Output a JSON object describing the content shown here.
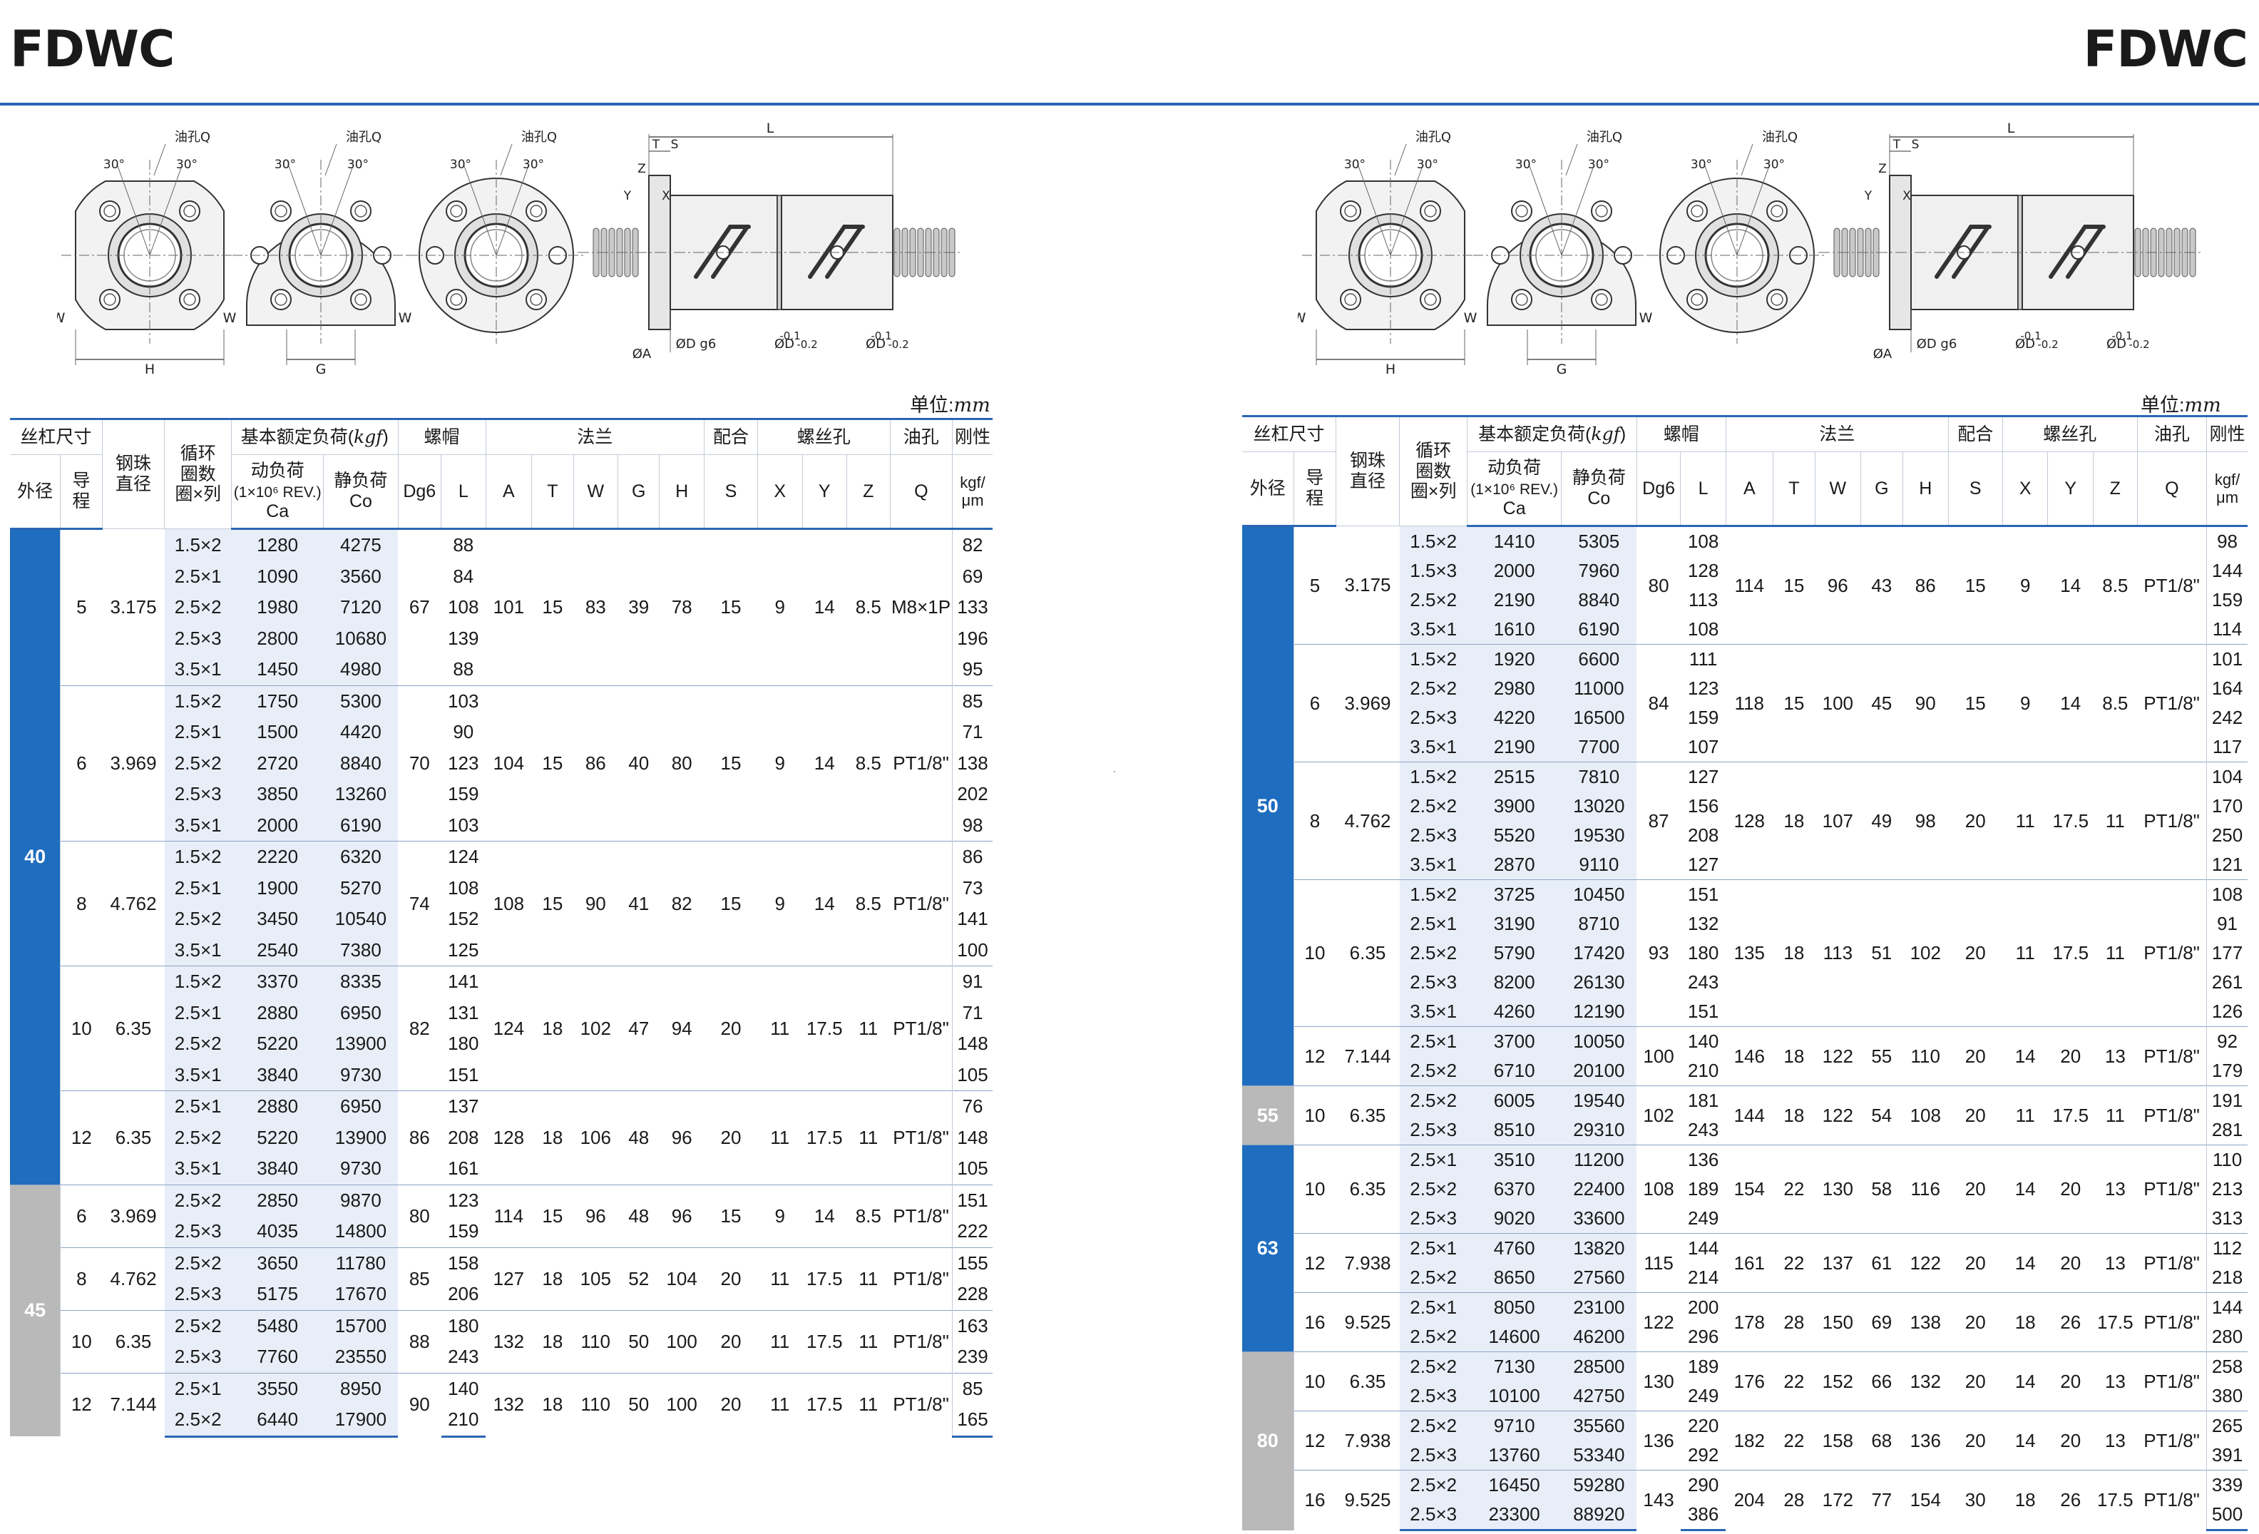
{
  "title": "FDWC",
  "unit_label": "单位:",
  "unit_value": "mm",
  "drawing": {
    "oil_hole": "油孔Q",
    "angle": "30°",
    "w": "W",
    "h": "H",
    "g": "G",
    "l": "L",
    "t": "T",
    "s": "S",
    "x": "X",
    "y": "Y",
    "z": "Z",
    "a": "ØA",
    "d_g6": "ØD g6",
    "d_tol": "ØD",
    "tol_value": "-0.1",
    "tol_value2": "-0.2"
  },
  "headers": {
    "shaft_size": "丝杠尺寸",
    "outer_dia": "外径",
    "lead": "导程",
    "ball_dia": "钢珠直径",
    "circuits": "循环圈数圈×列",
    "load_rating": "基本额定负荷(",
    "load_unit": "kgf",
    "load_close": ")",
    "dynamic": "动负荷",
    "dynamic_sub": "(1×10⁶ REV.)",
    "dynamic_ca": "Ca",
    "static": "静负荷",
    "static_co": "Co",
    "nut": "螺帽",
    "dg6": "Dg6",
    "l": "L",
    "flange": "法兰",
    "a": "A",
    "t": "T",
    "w": "W",
    "g": "G",
    "h": "H",
    "fit": "配合",
    "s": "S",
    "bolt": "螺丝孔",
    "x": "X",
    "y": "Y",
    "z": "Z",
    "oil": "油孔",
    "q": "Q",
    "rigidity": "刚性",
    "rig_unit": "kgf/μm"
  },
  "left_groups": [
    {
      "od": "40",
      "color": "blue",
      "sub": [
        {
          "lead": "5",
          "ball": "3.175",
          "dg6": "67",
          "A": "101",
          "T": "15",
          "W": "83",
          "G": "39",
          "H": "78",
          "S": "15",
          "X": "9",
          "Y": "14",
          "Z": "8.5",
          "Q": "M8×1P",
          "rows": [
            [
              "1.5×2",
              "1280",
              "4275",
              "88",
              "82"
            ],
            [
              "2.5×1",
              "1090",
              "3560",
              "84",
              "69"
            ],
            [
              "2.5×2",
              "1980",
              "7120",
              "108",
              "133"
            ],
            [
              "2.5×3",
              "2800",
              "10680",
              "139",
              "196"
            ],
            [
              "3.5×1",
              "1450",
              "4980",
              "88",
              "95"
            ]
          ]
        },
        {
          "lead": "6",
          "ball": "3.969",
          "dg6": "70",
          "A": "104",
          "T": "15",
          "W": "86",
          "G": "40",
          "H": "80",
          "S": "15",
          "X": "9",
          "Y": "14",
          "Z": "8.5",
          "Q": "PT1/8\"",
          "rows": [
            [
              "1.5×2",
              "1750",
              "5300",
              "103",
              "85"
            ],
            [
              "2.5×1",
              "1500",
              "4420",
              "90",
              "71"
            ],
            [
              "2.5×2",
              "2720",
              "8840",
              "123",
              "138"
            ],
            [
              "2.5×3",
              "3850",
              "13260",
              "159",
              "202"
            ],
            [
              "3.5×1",
              "2000",
              "6190",
              "103",
              "98"
            ]
          ]
        },
        {
          "lead": "8",
          "ball": "4.762",
          "dg6": "74",
          "A": "108",
          "T": "15",
          "W": "90",
          "G": "41",
          "H": "82",
          "S": "15",
          "X": "9",
          "Y": "14",
          "Z": "8.5",
          "Q": "PT1/8\"",
          "rows": [
            [
              "1.5×2",
              "2220",
              "6320",
              "124",
              "86"
            ],
            [
              "2.5×1",
              "1900",
              "5270",
              "108",
              "73"
            ],
            [
              "2.5×2",
              "3450",
              "10540",
              "152",
              "141"
            ],
            [
              "3.5×1",
              "2540",
              "7380",
              "125",
              "100"
            ]
          ]
        },
        {
          "lead": "10",
          "ball": "6.35",
          "dg6": "82",
          "A": "124",
          "T": "18",
          "W": "102",
          "G": "47",
          "H": "94",
          "S": "20",
          "X": "11",
          "Y": "17.5",
          "Z": "11",
          "Q": "PT1/8\"",
          "rows": [
            [
              "1.5×2",
              "3370",
              "8335",
              "141",
              "91"
            ],
            [
              "2.5×1",
              "2880",
              "6950",
              "131",
              "71"
            ],
            [
              "2.5×2",
              "5220",
              "13900",
              "180",
              "148"
            ],
            [
              "3.5×1",
              "3840",
              "9730",
              "151",
              "105"
            ]
          ]
        },
        {
          "lead": "12",
          "ball": "6.35",
          "dg6": "86",
          "A": "128",
          "T": "18",
          "W": "106",
          "G": "48",
          "H": "96",
          "S": "20",
          "X": "11",
          "Y": "17.5",
          "Z": "11",
          "Q": "PT1/8\"",
          "rows": [
            [
              "2.5×1",
              "2880",
              "6950",
              "137",
              "76"
            ],
            [
              "2.5×2",
              "5220",
              "13900",
              "208",
              "148"
            ],
            [
              "3.5×1",
              "3840",
              "9730",
              "161",
              "105"
            ]
          ]
        }
      ]
    },
    {
      "od": "45",
      "color": "gray",
      "sub": [
        {
          "lead": "6",
          "ball": "3.969",
          "dg6": "80",
          "A": "114",
          "T": "15",
          "W": "96",
          "G": "48",
          "H": "96",
          "S": "15",
          "X": "9",
          "Y": "14",
          "Z": "8.5",
          "Q": "PT1/8\"",
          "rows": [
            [
              "2.5×2",
              "2850",
              "9870",
              "123",
              "151"
            ],
            [
              "2.5×3",
              "4035",
              "14800",
              "159",
              "222"
            ]
          ]
        },
        {
          "lead": "8",
          "ball": "4.762",
          "dg6": "85",
          "A": "127",
          "T": "18",
          "W": "105",
          "G": "52",
          "H": "104",
          "S": "20",
          "X": "11",
          "Y": "17.5",
          "Z": "11",
          "Q": "PT1/8\"",
          "rows": [
            [
              "2.5×2",
              "3650",
              "11780",
              "158",
              "155"
            ],
            [
              "2.5×3",
              "5175",
              "17670",
              "206",
              "228"
            ]
          ]
        },
        {
          "lead": "10",
          "ball": "6.35",
          "dg6": "88",
          "A": "132",
          "T": "18",
          "W": "110",
          "G": "50",
          "H": "100",
          "S": "20",
          "X": "11",
          "Y": "17.5",
          "Z": "11",
          "Q": "PT1/8\"",
          "rows": [
            [
              "2.5×2",
              "5480",
              "15700",
              "180",
              "163"
            ],
            [
              "2.5×3",
              "7760",
              "23550",
              "243",
              "239"
            ]
          ]
        },
        {
          "lead": "12",
          "ball": "7.144",
          "dg6": "90",
          "A": "132",
          "T": "18",
          "W": "110",
          "G": "50",
          "H": "100",
          "S": "20",
          "X": "11",
          "Y": "17.5",
          "Z": "11",
          "Q": "PT1/8\"",
          "rows": [
            [
              "2.5×1",
              "3550",
              "8950",
              "140",
              "85"
            ],
            [
              "2.5×2",
              "6440",
              "17900",
              "210",
              "165"
            ]
          ]
        }
      ]
    }
  ],
  "right_groups": [
    {
      "od": "50",
      "color": "blue",
      "sub": [
        {
          "lead": "5",
          "ball": "3.175",
          "dg6": "80",
          "A": "114",
          "T": "15",
          "W": "96",
          "G": "43",
          "H": "86",
          "S": "15",
          "X": "9",
          "Y": "14",
          "Z": "8.5",
          "Q": "PT1/8\"",
          "rows": [
            [
              "1.5×2",
              "1410",
              "5305",
              "108",
              "98"
            ],
            [
              "1.5×3",
              "2000",
              "7960",
              "128",
              "144"
            ],
            [
              "2.5×2",
              "2190",
              "8840",
              "113",
              "159"
            ],
            [
              "3.5×1",
              "1610",
              "6190",
              "108",
              "114"
            ]
          ]
        },
        {
          "lead": "6",
          "ball": "3.969",
          "dg6": "84",
          "A": "118",
          "T": "15",
          "W": "100",
          "G": "45",
          "H": "90",
          "S": "15",
          "X": "9",
          "Y": "14",
          "Z": "8.5",
          "Q": "PT1/8\"",
          "rows": [
            [
              "1.5×2",
              "1920",
              "6600",
              "111",
              "101"
            ],
            [
              "2.5×2",
              "2980",
              "11000",
              "123",
              "164"
            ],
            [
              "2.5×3",
              "4220",
              "16500",
              "159",
              "242"
            ],
            [
              "3.5×1",
              "2190",
              "7700",
              "107",
              "117"
            ]
          ]
        },
        {
          "lead": "8",
          "ball": "4.762",
          "dg6": "87",
          "A": "128",
          "T": "18",
          "W": "107",
          "G": "49",
          "H": "98",
          "S": "20",
          "X": "11",
          "Y": "17.5",
          "Z": "11",
          "Q": "PT1/8\"",
          "rows": [
            [
              "1.5×2",
              "2515",
              "7810",
              "127",
              "104"
            ],
            [
              "2.5×2",
              "3900",
              "13020",
              "156",
              "170"
            ],
            [
              "2.5×3",
              "5520",
              "19530",
              "208",
              "250"
            ],
            [
              "3.5×1",
              "2870",
              "9110",
              "127",
              "121"
            ]
          ]
        },
        {
          "lead": "10",
          "ball": "6.35",
          "dg6": "93",
          "A": "135",
          "T": "18",
          "W": "113",
          "G": "51",
          "H": "102",
          "S": "20",
          "X": "11",
          "Y": "17.5",
          "Z": "11",
          "Q": "PT1/8\"",
          "rows": [
            [
              "1.5×2",
              "3725",
              "10450",
              "151",
              "108"
            ],
            [
              "2.5×1",
              "3190",
              "8710",
              "132",
              "91"
            ],
            [
              "2.5×2",
              "5790",
              "17420",
              "180",
              "177"
            ],
            [
              "2.5×3",
              "8200",
              "26130",
              "243",
              "261"
            ],
            [
              "3.5×1",
              "4260",
              "12190",
              "151",
              "126"
            ]
          ]
        },
        {
          "lead": "12",
          "ball": "7.144",
          "dg6": "100",
          "A": "146",
          "T": "18",
          "W": "122",
          "G": "55",
          "H": "110",
          "S": "20",
          "X": "14",
          "Y": "20",
          "Z": "13",
          "Q": "PT1/8\"",
          "rows": [
            [
              "2.5×1",
              "3700",
              "10050",
              "140",
              "92"
            ],
            [
              "2.5×2",
              "6710",
              "20100",
              "210",
              "179"
            ]
          ]
        }
      ]
    },
    {
      "od": "55",
      "color": "gray",
      "sub": [
        {
          "lead": "10",
          "ball": "6.35",
          "dg6": "102",
          "A": "144",
          "T": "18",
          "W": "122",
          "G": "54",
          "H": "108",
          "S": "20",
          "X": "11",
          "Y": "17.5",
          "Z": "11",
          "Q": "PT1/8\"",
          "rows": [
            [
              "2.5×2",
              "6005",
              "19540",
              "181",
              "191"
            ],
            [
              "2.5×3",
              "8510",
              "29310",
              "243",
              "281"
            ]
          ]
        }
      ]
    },
    {
      "od": "63",
      "color": "blue",
      "sub": [
        {
          "lead": "10",
          "ball": "6.35",
          "dg6": "108",
          "A": "154",
          "T": "22",
          "W": "130",
          "G": "58",
          "H": "116",
          "S": "20",
          "X": "14",
          "Y": "20",
          "Z": "13",
          "Q": "PT1/8\"",
          "rows": [
            [
              "2.5×1",
              "3510",
              "11200",
              "136",
              "110"
            ],
            [
              "2.5×2",
              "6370",
              "22400",
              "189",
              "213"
            ],
            [
              "2.5×3",
              "9020",
              "33600",
              "249",
              "313"
            ]
          ]
        },
        {
          "lead": "12",
          "ball": "7.938",
          "dg6": "115",
          "A": "161",
          "T": "22",
          "W": "137",
          "G": "61",
          "H": "122",
          "S": "20",
          "X": "14",
          "Y": "20",
          "Z": "13",
          "Q": "PT1/8\"",
          "rows": [
            [
              "2.5×1",
              "4760",
              "13820",
              "144",
              "112"
            ],
            [
              "2.5×2",
              "8650",
              "27560",
              "214",
              "218"
            ]
          ]
        },
        {
          "lead": "16",
          "ball": "9.525",
          "dg6": "122",
          "A": "178",
          "T": "28",
          "W": "150",
          "G": "69",
          "H": "138",
          "S": "20",
          "X": "18",
          "Y": "26",
          "Z": "17.5",
          "Q": "PT1/8\"",
          "rows": [
            [
              "2.5×1",
              "8050",
              "23100",
              "200",
              "144"
            ],
            [
              "2.5×2",
              "14600",
              "46200",
              "296",
              "280"
            ]
          ]
        }
      ]
    },
    {
      "od": "80",
      "color": "gray",
      "sub": [
        {
          "lead": "10",
          "ball": "6.35",
          "dg6": "130",
          "A": "176",
          "T": "22",
          "W": "152",
          "G": "66",
          "H": "132",
          "S": "20",
          "X": "14",
          "Y": "20",
          "Z": "13",
          "Q": "PT1/8\"",
          "rows": [
            [
              "2.5×2",
              "7130",
              "28500",
              "189",
              "258"
            ],
            [
              "2.5×3",
              "10100",
              "42750",
              "249",
              "380"
            ]
          ]
        },
        {
          "lead": "12",
          "ball": "7.938",
          "dg6": "136",
          "A": "182",
          "T": "22",
          "W": "158",
          "G": "68",
          "H": "136",
          "S": "20",
          "X": "14",
          "Y": "20",
          "Z": "13",
          "Q": "PT1/8\"",
          "rows": [
            [
              "2.5×2",
              "9710",
              "35560",
              "220",
              "265"
            ],
            [
              "2.5×3",
              "13760",
              "53340",
              "292",
              "391"
            ]
          ]
        },
        {
          "lead": "16",
          "ball": "9.525",
          "dg6": "143",
          "A": "204",
          "T": "28",
          "W": "172",
          "G": "77",
          "H": "154",
          "S": "30",
          "X": "18",
          "Y": "26",
          "Z": "17.5",
          "Q": "PT1/8\"",
          "rows": [
            [
              "2.5×2",
              "16450",
              "59280",
              "290",
              "339"
            ],
            [
              "2.5×3",
              "23300",
              "88920",
              "386",
              "500"
            ]
          ]
        }
      ]
    }
  ]
}
